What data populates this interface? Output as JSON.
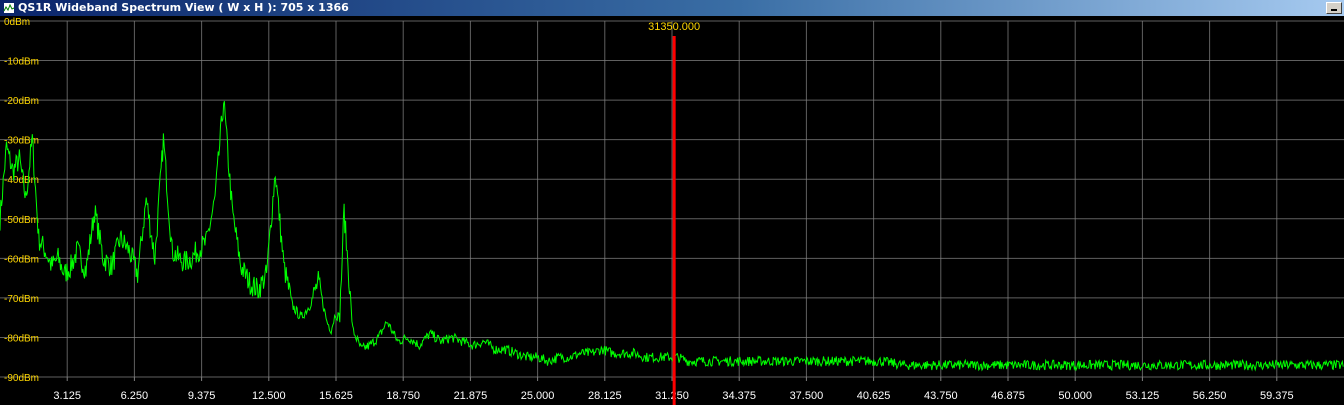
{
  "window": {
    "title": "QS1R Wideband Spectrum View ( W x H ): 705 x 1366"
  },
  "marker": {
    "label": "31350.000",
    "frequency": 31.35,
    "color": "#ff0000"
  },
  "colors": {
    "trace": "#00ff00",
    "grid": "#808080",
    "ylabel": "#ffd700",
    "xlabel": "#ffffff",
    "background": "#000000"
  },
  "chart_data": {
    "type": "line",
    "title": "",
    "xlabel": "",
    "ylabel": "",
    "xlim": [
      0,
      62.5
    ],
    "ylim": [
      -90,
      0
    ],
    "grid": true,
    "x_ticks": [
      3.125,
      6.25,
      9.375,
      12.5,
      15.625,
      18.75,
      21.875,
      25.0,
      28.125,
      31.25,
      34.375,
      37.5,
      40.625,
      43.75,
      46.875,
      50.0,
      53.125,
      56.25,
      59.375
    ],
    "x_tick_labels": [
      "3.125",
      "6.250",
      "9.375",
      "12.500",
      "15.625",
      "18.750",
      "21.875",
      "25.000",
      "28.125",
      "31.250",
      "34.375",
      "37.500",
      "40.625",
      "43.750",
      "46.875",
      "50.000",
      "53.125",
      "56.250",
      "59.375"
    ],
    "y_ticks": [
      0,
      -10,
      -20,
      -30,
      -40,
      -50,
      -60,
      -70,
      -80,
      -90
    ],
    "y_tick_labels": [
      "0dBm",
      "-10dBm",
      "-20dBm",
      "-30dBm",
      "-40dBm",
      "-50dBm",
      "-60dBm",
      "-70dBm",
      "-80dBm",
      "-90dBm"
    ],
    "series": [
      {
        "x": [
          0,
          0.3,
          0.6,
          0.9,
          1.2,
          1.5,
          1.8,
          2.1,
          2.4,
          2.7,
          3.0,
          3.3,
          3.6,
          4.0,
          4.4,
          4.8,
          5.2,
          5.6,
          6.0,
          6.4,
          6.8,
          7.2,
          7.6,
          8.0,
          8.3,
          8.6,
          8.9,
          9.2,
          9.6,
          10.0,
          10.4,
          10.8,
          11.2,
          11.6,
          12.0,
          12.4,
          12.8,
          13.2,
          13.6,
          14.0,
          14.4,
          14.8,
          15.2,
          15.4,
          15.6,
          15.8,
          16.0,
          16.4,
          16.8,
          17.2,
          17.6,
          18.0,
          18.5,
          19.0,
          19.5,
          20.0,
          20.5,
          21.0,
          21.5,
          22.0,
          22.5,
          23.0,
          23.5,
          24.0,
          24.5,
          25.0,
          25.5,
          26.0,
          26.5,
          27.0,
          27.5,
          28.0,
          28.5,
          29.0,
          29.5,
          30.0,
          30.5,
          31.0,
          31.5,
          32.0,
          33.0,
          34.0,
          35.0,
          36.0,
          37.0,
          38.0,
          39.0,
          40.0,
          41.0,
          42.0,
          43.0,
          44.0,
          45.0,
          46.0,
          47.0,
          47.2,
          47.4,
          48.0,
          49.0,
          49.6,
          49.8,
          50.0,
          51.0,
          52.0,
          53.0,
          54.0,
          55.0,
          56.0,
          57.0,
          58.0,
          59.0,
          60.0,
          61.0,
          62.0,
          62.5
        ],
        "y": [
          -50,
          -32,
          -38,
          -35,
          -45,
          -30,
          -55,
          -58,
          -62,
          -60,
          -64,
          -62,
          -58,
          -63,
          -48,
          -60,
          -62,
          -55,
          -58,
          -64,
          -45,
          -60,
          -30,
          -58,
          -60,
          -61,
          -60,
          -58,
          -56,
          -45,
          -20,
          -48,
          -62,
          -66,
          -68,
          -64,
          -38,
          -62,
          -72,
          -75,
          -72,
          -66,
          -76,
          -78,
          -74,
          -75,
          -48,
          -78,
          -83,
          -82,
          -80,
          -76,
          -81,
          -80,
          -82,
          -79,
          -81,
          -80,
          -81,
          -82,
          -81,
          -83,
          -83,
          -84,
          -85,
          -85,
          -86,
          -85,
          -85,
          -84,
          -84,
          -83,
          -84,
          -84,
          -84,
          -85,
          -85,
          -85,
          -85,
          -86,
          -86,
          -86,
          -86,
          -86,
          -86,
          -86,
          -86,
          -86,
          -86,
          -87,
          -87,
          -87,
          -87,
          -87,
          -87,
          -87,
          -87,
          -87,
          -87,
          -87,
          -87,
          -87,
          -87,
          -87,
          -87,
          -87,
          -87,
          -87,
          -87,
          -87,
          -87,
          -87,
          -87,
          -87,
          -87
        ]
      }
    ]
  }
}
